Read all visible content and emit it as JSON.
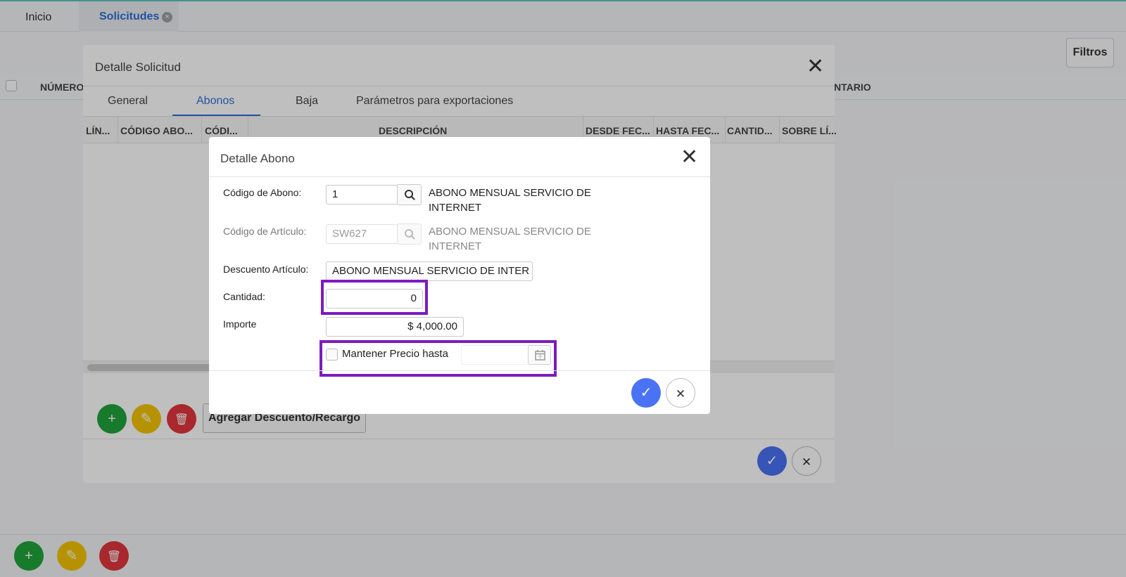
{
  "top_tabs": {
    "inicio": "Inicio",
    "solicitudes": "Solicitudes",
    "close": "×"
  },
  "background": {
    "filtros": "Filtros",
    "col_numero": "NÚMERO",
    "col_comentario": "NTARIO"
  },
  "modal1": {
    "title": "Detalle Solicitud",
    "close": "✕",
    "tabs": [
      "General",
      "Abonos",
      "Baja",
      "Parámetros para exportaciones"
    ],
    "active_tab": "Abonos",
    "columns": [
      "LÍN...",
      "CÓDIGO ABO...",
      "CÓDI...",
      "DESCRIPCIÓN",
      "DESDE FEC...",
      "HASTA FEC...",
      "CANTID...",
      "SOBRE LÍ..."
    ],
    "agregar": "Agregar Descuento/Recargo"
  },
  "modal2": {
    "title": "Detalle Abono",
    "close": "✕",
    "codigo_abono": {
      "label": "Código de Abono:",
      "value": "1",
      "desc_line1": "ABONO MENSUAL SERVICIO DE",
      "desc_line2": "INTERNET"
    },
    "codigo_articulo": {
      "label": "Código de Artículo:",
      "value": "SW627",
      "desc_line1": "ABONO MENSUAL SERVICIO DE",
      "desc_line2": "INTERNET"
    },
    "descuento_articulo": {
      "label": "Descuento Artículo:",
      "value": "ABONO MENSUAL SERVICIO DE INTER"
    },
    "cantidad": {
      "label": "Cantidad:",
      "value": "0"
    },
    "importe": {
      "label": "Importe",
      "value": "$ 4,000.00"
    },
    "mantener": {
      "label": "Mantener Precio hasta",
      "checked": false,
      "date": ""
    }
  },
  "icons": {
    "accept": "✓",
    "cancel": "✕",
    "add": "+",
    "edit": "✎",
    "delete": "🗑"
  },
  "colors": {
    "accent": "#2e6fd8",
    "highlight": "#7d1bbf",
    "green": "#21a33a",
    "yellow": "#f3c300",
    "red": "#e0363c",
    "blue": "#4a72f5"
  }
}
